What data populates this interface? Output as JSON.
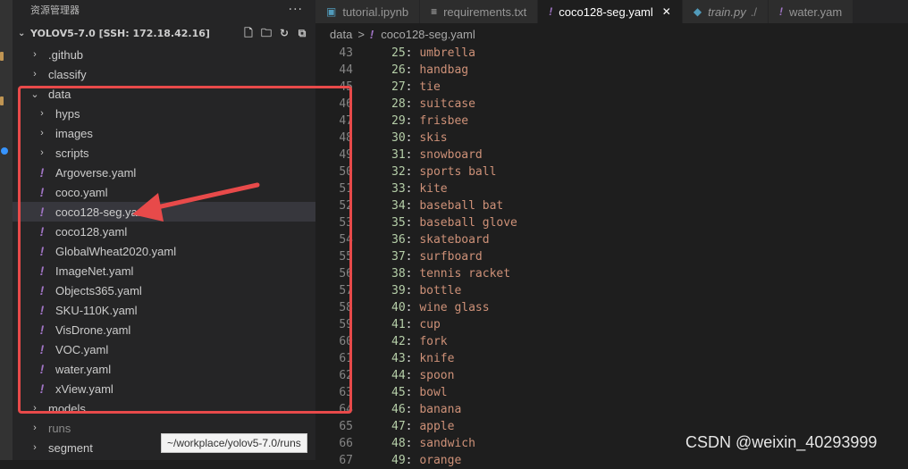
{
  "explorer": {
    "title": "资源管理器",
    "more": "···",
    "folder": "YOLOV5-7.0 [SSH: 172.18.42.16]"
  },
  "tree": [
    {
      "label": ".github",
      "type": "folder",
      "depth": 0,
      "open": false
    },
    {
      "label": "classify",
      "type": "folder",
      "depth": 0,
      "open": false
    },
    {
      "label": "data",
      "type": "folder",
      "depth": 0,
      "open": true
    },
    {
      "label": "hyps",
      "type": "folder",
      "depth": 1,
      "open": false
    },
    {
      "label": "images",
      "type": "folder",
      "depth": 1,
      "open": false
    },
    {
      "label": "scripts",
      "type": "folder",
      "depth": 1,
      "open": false
    },
    {
      "label": "Argoverse.yaml",
      "type": "yaml",
      "depth": 1
    },
    {
      "label": "coco.yaml",
      "type": "yaml",
      "depth": 1
    },
    {
      "label": "coco128-seg.yaml",
      "type": "yaml",
      "depth": 1,
      "selected": true
    },
    {
      "label": "coco128.yaml",
      "type": "yaml",
      "depth": 1
    },
    {
      "label": "GlobalWheat2020.yaml",
      "type": "yaml",
      "depth": 1
    },
    {
      "label": "ImageNet.yaml",
      "type": "yaml",
      "depth": 1
    },
    {
      "label": "Objects365.yaml",
      "type": "yaml",
      "depth": 1
    },
    {
      "label": "SKU-110K.yaml",
      "type": "yaml",
      "depth": 1
    },
    {
      "label": "VisDrone.yaml",
      "type": "yaml",
      "depth": 1
    },
    {
      "label": "VOC.yaml",
      "type": "yaml",
      "depth": 1
    },
    {
      "label": "water.yaml",
      "type": "yaml",
      "depth": 1
    },
    {
      "label": "xView.yaml",
      "type": "yaml",
      "depth": 1
    },
    {
      "label": "models",
      "type": "folder",
      "depth": 0,
      "open": false
    },
    {
      "label": "runs",
      "type": "folder",
      "depth": 0,
      "open": false,
      "dim": true
    },
    {
      "label": "segment",
      "type": "folder",
      "depth": 0,
      "open": false
    }
  ],
  "tooltip": "~/workplace/yolov5-7.0/runs",
  "tabs": [
    {
      "label": "tutorial.ipynb",
      "icon": "notebook-icon",
      "active": false
    },
    {
      "label": "requirements.txt",
      "icon": "text-file-icon",
      "active": false
    },
    {
      "label": "coco128-seg.yaml",
      "icon": "yaml-icon",
      "active": true,
      "close": "✕"
    },
    {
      "label": "train.py",
      "icon": "python-icon",
      "active": false,
      "italic": true,
      "suffix": "./"
    },
    {
      "label": "water.yam",
      "icon": "yaml-icon",
      "active": false
    }
  ],
  "breadcrumb": {
    "root": "data",
    "sep": ">",
    "file": "coco128-seg.yaml"
  },
  "code": [
    {
      "ln": "43",
      "key": "25",
      "val": "umbrella"
    },
    {
      "ln": "44",
      "key": "26",
      "val": "handbag"
    },
    {
      "ln": "45",
      "key": "27",
      "val": "tie"
    },
    {
      "ln": "46",
      "key": "28",
      "val": "suitcase"
    },
    {
      "ln": "47",
      "key": "29",
      "val": "frisbee"
    },
    {
      "ln": "48",
      "key": "30",
      "val": "skis"
    },
    {
      "ln": "49",
      "key": "31",
      "val": "snowboard"
    },
    {
      "ln": "50",
      "key": "32",
      "val": "sports ball"
    },
    {
      "ln": "51",
      "key": "33",
      "val": "kite"
    },
    {
      "ln": "52",
      "key": "34",
      "val": "baseball bat"
    },
    {
      "ln": "53",
      "key": "35",
      "val": "baseball glove"
    },
    {
      "ln": "54",
      "key": "36",
      "val": "skateboard"
    },
    {
      "ln": "55",
      "key": "37",
      "val": "surfboard"
    },
    {
      "ln": "56",
      "key": "38",
      "val": "tennis racket"
    },
    {
      "ln": "57",
      "key": "39",
      "val": "bottle"
    },
    {
      "ln": "58",
      "key": "40",
      "val": "wine glass"
    },
    {
      "ln": "59",
      "key": "41",
      "val": "cup"
    },
    {
      "ln": "60",
      "key": "42",
      "val": "fork"
    },
    {
      "ln": "61",
      "key": "43",
      "val": "knife"
    },
    {
      "ln": "62",
      "key": "44",
      "val": "spoon"
    },
    {
      "ln": "63",
      "key": "45",
      "val": "bowl"
    },
    {
      "ln": "64",
      "key": "46",
      "val": "banana"
    },
    {
      "ln": "65",
      "key": "47",
      "val": "apple"
    },
    {
      "ln": "66",
      "key": "48",
      "val": "sandwich"
    },
    {
      "ln": "67",
      "key": "49",
      "val": "orange"
    }
  ],
  "watermark": "CSDN @weixin_40293999",
  "colors": {
    "annotation": "#e84a4a",
    "yaml": "#a074c4",
    "key": "#b5cea8",
    "value": "#ce9178"
  }
}
